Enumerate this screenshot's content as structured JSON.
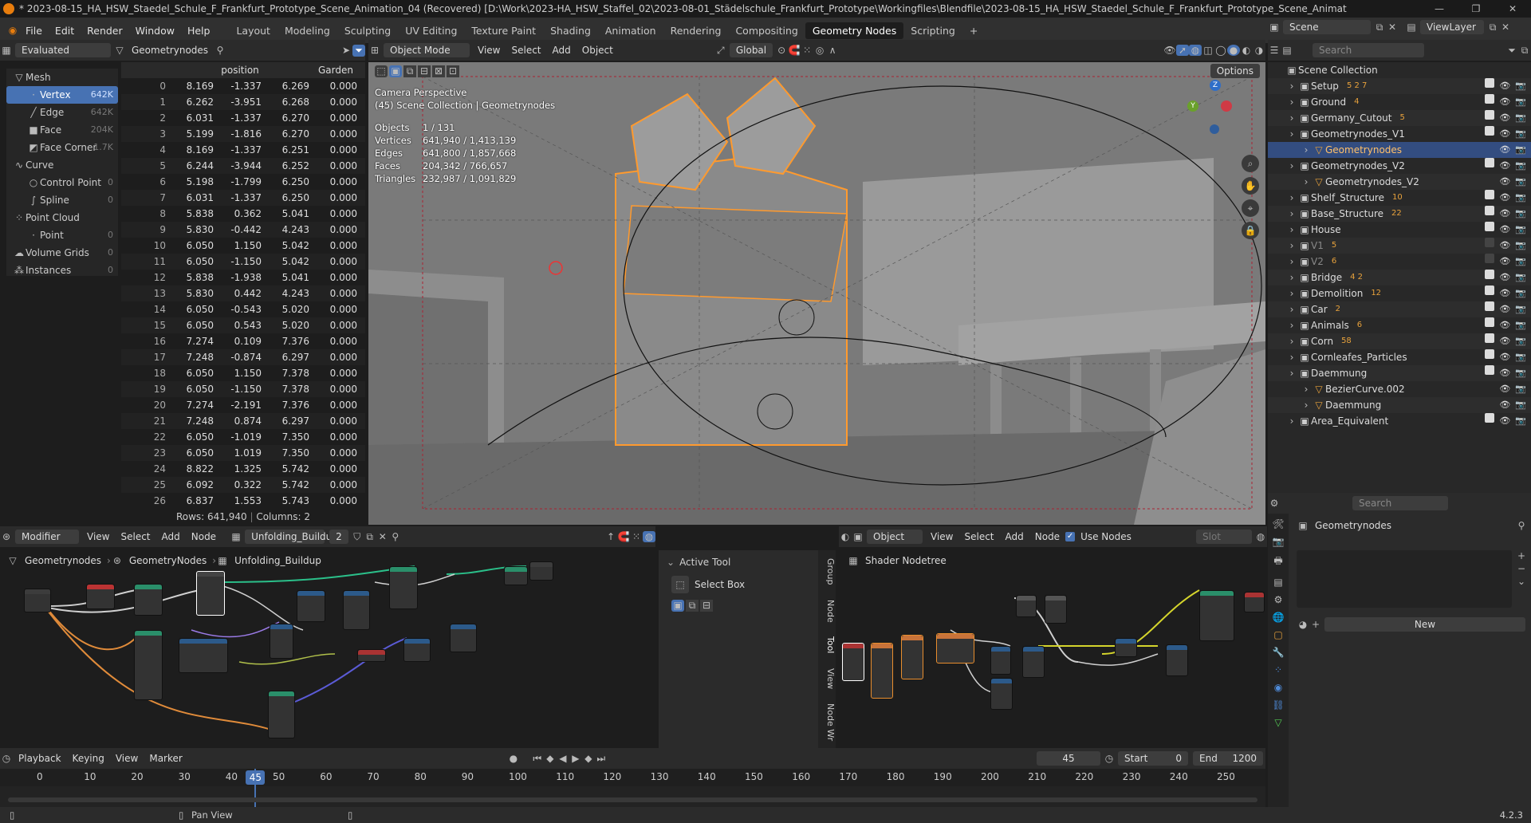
{
  "window": {
    "title": "* 2023-08-15_HA_HSW_Staedel_Schule_F_Frankfurt_Prototype_Scene_Animation_04 (Recovered) [D:\\Work\\2023-HA_HSW_Staffel_02\\2023-08-01_Städelschule_Frankfurt_Prototype\\Workingfiles\\Blendfile\\2023-08-15_HA_HSW_Staedel_Schule_F_Frankfurt_Prototype_Scene_Animat"
  },
  "menu": [
    "File",
    "Edit",
    "Render",
    "Window",
    "Help"
  ],
  "workspaces": [
    "Layout",
    "Modeling",
    "Sculpting",
    "UV Editing",
    "Texture Paint",
    "Shading",
    "Animation",
    "Rendering",
    "Compositing",
    "Geometry Nodes",
    "Scripting"
  ],
  "active_workspace": "Geometry Nodes",
  "scene": {
    "name": "Scene",
    "view_layer": "ViewLayer"
  },
  "spreadsheet": {
    "mode": "Evaluated",
    "object": "Geometrynodes",
    "tree": [
      {
        "label": "Mesh",
        "count": "",
        "level": 0
      },
      {
        "label": "Vertex",
        "count": "642K",
        "level": 1,
        "selected": true
      },
      {
        "label": "Edge",
        "count": "642K",
        "level": 1
      },
      {
        "label": "Face",
        "count": "204K",
        "level": 1
      },
      {
        "label": "Face Corner",
        "count": "1.7K",
        "level": 1
      },
      {
        "label": "Curve",
        "count": "",
        "level": 0
      },
      {
        "label": "Control Point",
        "count": "0",
        "level": 1
      },
      {
        "label": "Spline",
        "count": "0",
        "level": 1
      },
      {
        "label": "Point Cloud",
        "count": "",
        "level": 0
      },
      {
        "label": "Point",
        "count": "0",
        "level": 1
      },
      {
        "label": "Volume Grids",
        "count": "0",
        "level": 0
      },
      {
        "label": "Instances",
        "count": "0",
        "level": 0
      }
    ],
    "columns": [
      "position",
      "Garden"
    ],
    "rows": [
      [
        "0",
        "8.169",
        "-1.337",
        "6.269",
        "0.000"
      ],
      [
        "1",
        "6.262",
        "-3.951",
        "6.268",
        "0.000"
      ],
      [
        "2",
        "6.031",
        "-1.337",
        "6.270",
        "0.000"
      ],
      [
        "3",
        "5.199",
        "-1.816",
        "6.270",
        "0.000"
      ],
      [
        "4",
        "8.169",
        "-1.337",
        "6.251",
        "0.000"
      ],
      [
        "5",
        "6.244",
        "-3.944",
        "6.252",
        "0.000"
      ],
      [
        "6",
        "5.198",
        "-1.799",
        "6.250",
        "0.000"
      ],
      [
        "7",
        "6.031",
        "-1.337",
        "6.250",
        "0.000"
      ],
      [
        "8",
        "5.838",
        "0.362",
        "5.041",
        "0.000"
      ],
      [
        "9",
        "5.830",
        "-0.442",
        "4.243",
        "0.000"
      ],
      [
        "10",
        "6.050",
        "1.150",
        "5.042",
        "0.000"
      ],
      [
        "11",
        "6.050",
        "-1.150",
        "5.042",
        "0.000"
      ],
      [
        "12",
        "5.838",
        "-1.938",
        "5.041",
        "0.000"
      ],
      [
        "13",
        "5.830",
        "0.442",
        "4.243",
        "0.000"
      ],
      [
        "14",
        "6.050",
        "-0.543",
        "5.020",
        "0.000"
      ],
      [
        "15",
        "6.050",
        "0.543",
        "5.020",
        "0.000"
      ],
      [
        "16",
        "7.274",
        "0.109",
        "7.376",
        "0.000"
      ],
      [
        "17",
        "7.248",
        "-0.874",
        "6.297",
        "0.000"
      ],
      [
        "18",
        "6.050",
        "1.150",
        "7.378",
        "0.000"
      ],
      [
        "19",
        "6.050",
        "-1.150",
        "7.378",
        "0.000"
      ],
      [
        "20",
        "7.274",
        "-2.191",
        "7.376",
        "0.000"
      ],
      [
        "21",
        "7.248",
        "0.874",
        "6.297",
        "0.000"
      ],
      [
        "22",
        "6.050",
        "-1.019",
        "7.350",
        "0.000"
      ],
      [
        "23",
        "6.050",
        "1.019",
        "7.350",
        "0.000"
      ],
      [
        "24",
        "8.822",
        "1.325",
        "5.742",
        "0.000"
      ],
      [
        "25",
        "6.092",
        "0.322",
        "5.742",
        "0.000"
      ],
      [
        "26",
        "6.837",
        "1.553",
        "5.743",
        "0.000"
      ]
    ],
    "status_rows": "Rows: 641,940",
    "status_cols": "Columns: 2"
  },
  "viewport": {
    "mode": "Object Mode",
    "menus": [
      "View",
      "Select",
      "Add",
      "Object"
    ],
    "orientation": "Global",
    "options": "Options",
    "perspective": "Camera Perspective",
    "collection": "(45) Scene Collection | Geometrynodes",
    "stats": [
      {
        "label": "Objects",
        "value": "1 / 131"
      },
      {
        "label": "Vertices",
        "value": "641,940 / 1,413,139"
      },
      {
        "label": "Edges",
        "value": "641,800 / 1,857,668"
      },
      {
        "label": "Faces",
        "value": "204,342 / 766,657"
      },
      {
        "label": "Triangles",
        "value": "232,987 / 1,091,829"
      }
    ]
  },
  "outliner": {
    "search_placeholder": "Search",
    "root": "Scene Collection",
    "items": [
      {
        "label": "Setup",
        "level": 0,
        "badge": "5  2  7"
      },
      {
        "label": "Ground",
        "level": 0,
        "badge": "4"
      },
      {
        "label": "Germany_Cutout",
        "level": 0,
        "badge": "5"
      },
      {
        "label": "Geometrynodes_V1",
        "level": 0,
        "badge": ""
      },
      {
        "label": "Geometrynodes",
        "level": 1,
        "badge": "",
        "selected": true
      },
      {
        "label": "Geometrynodes_V2",
        "level": 0,
        "badge": ""
      },
      {
        "label": "Geometrynodes_V2",
        "level": 1,
        "badge": ""
      },
      {
        "label": "Shelf_Structure",
        "level": 0,
        "badge": "10"
      },
      {
        "label": "Base_Structure",
        "level": 0,
        "badge": "22"
      },
      {
        "label": "House",
        "level": 0,
        "badge": ""
      },
      {
        "label": "V1",
        "level": 0,
        "badge": "5",
        "dim": true
      },
      {
        "label": "V2",
        "level": 0,
        "badge": "6",
        "dim": true
      },
      {
        "label": "Bridge",
        "level": 0,
        "badge": "4  2"
      },
      {
        "label": "Demolition",
        "level": 0,
        "badge": "12"
      },
      {
        "label": "Car",
        "level": 0,
        "badge": "2"
      },
      {
        "label": "Animals",
        "level": 0,
        "badge": "6"
      },
      {
        "label": "Corn",
        "level": 0,
        "badge": "58"
      },
      {
        "label": "Cornleafes_Particles",
        "level": 0,
        "badge": ""
      },
      {
        "label": "Daemmung",
        "level": 0,
        "badge": ""
      },
      {
        "label": "BezierCurve.002",
        "level": 1,
        "badge": ""
      },
      {
        "label": "Daemmung",
        "level": 1,
        "badge": ""
      },
      {
        "label": "Area_Equivalent",
        "level": 0,
        "badge": ""
      }
    ]
  },
  "properties": {
    "search_placeholder": "Search",
    "object": "Geometrynodes",
    "new_button": "New"
  },
  "geo_nodes": {
    "editor": "Modifier",
    "menus": [
      "View",
      "Select",
      "Add",
      "Node"
    ],
    "tree_name": "Unfolding_Buildup",
    "users": "2",
    "breadcrumb": [
      "Geometrynodes",
      "GeometryNodes",
      "Unfolding_Buildup"
    ]
  },
  "node_sidebar": {
    "section": "Active Tool",
    "tool": "Select Box",
    "tabs": [
      "Group",
      "Node",
      "Tool",
      "View",
      "Node Wr"
    ]
  },
  "shader": {
    "editor": "Object",
    "menus": [
      "View",
      "Select",
      "Add",
      "Node"
    ],
    "use_nodes": "Use Nodes",
    "slot": "Slot",
    "breadcrumb": "Shader Nodetree"
  },
  "timeline": {
    "menus": [
      "Playback",
      "Keying",
      "View",
      "Marker"
    ],
    "current_frame": "45",
    "start_label": "Start",
    "start": "0",
    "end_label": "End",
    "end": "1200",
    "ticks": [
      "0",
      "10",
      "20",
      "30",
      "40",
      "50",
      "60",
      "70",
      "80",
      "90",
      "100",
      "110",
      "120",
      "130",
      "140",
      "150",
      "160",
      "170",
      "180",
      "190",
      "200",
      "210",
      "220",
      "230",
      "240",
      "250"
    ]
  },
  "statusbar": {
    "left": "Pan View",
    "version": "4.2.3"
  },
  "colors": {
    "accent": "#4772b3",
    "selection": "#ff9a2e",
    "active_ws": "#1d1d1d"
  }
}
